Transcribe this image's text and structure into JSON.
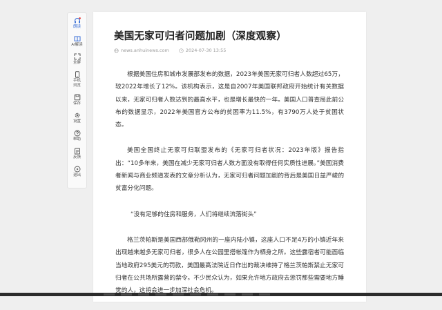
{
  "toolbar": {
    "items": [
      {
        "label": "朗读",
        "icon": "headphones-icon"
      },
      {
        "label": "AI解读",
        "icon": "book-icon"
      },
      {
        "label": "全屏",
        "icon": "fullscreen-icon"
      },
      {
        "label": "手机\n浏览",
        "icon": "phone-icon"
      },
      {
        "label": "保存",
        "icon": "save-icon"
      },
      {
        "label": "设置",
        "icon": "gear-icon"
      },
      {
        "label": "帮助",
        "icon": "help-icon"
      },
      {
        "label": "反馈",
        "icon": "feedback-icon"
      },
      {
        "label": "退出",
        "icon": "exit-icon"
      }
    ],
    "accent": "#3a6fd6",
    "badge_color": "#e53935"
  },
  "article": {
    "title": "美国无家可归者问题加剧（深度观察）",
    "source": "news.anhuinews.com",
    "date": "2024-07-30 13:55",
    "paragraphs": [
      "根据美国住房和城市发展部发布的数据，2023年美国无家可归者人数超过65万，较2022年增长了12%。该机构表示，这是自2007年美国联邦政府开始统计有关数据以来，无家可归者人数达到的最高水平，也是增长最快的一年。美国人口普查局此前公布的数据显示，2022年美国官方公布的贫困率为11.5%，有3790万人处于贫困状态。",
      "美国全国终止无家可归联盟发布的《无家可归者状况：2023年版》报告指出：“10多年来，美国在减少无家可归者人数方面没有取得任何实质性进展。”美国消费者新闻与商业频道发表的文章分析认为，无家可归者问题加剧的背后是美国日益严峻的贫富分化问题。",
      "“没有足够的住房和服务，人们将继续流落街头”",
      "格兰茨帕斯是美国西部俄勒冈州的一座内陆小镇，这座人口不足4万的小镇近年来出现越来越多无家可归者，很多人在公园里搭帐篷作为栖身之所。这些露宿者可能面临当地政府295美元的罚款，美国最高法院近日作出的裁决维持了格兰茨帕斯禁止无家可归者在公共场所露营的禁令。不少民众认为，如果允许地方政府去惩罚那些需要地方睡觉的人，这将会进一步加深社会危机。"
    ]
  }
}
